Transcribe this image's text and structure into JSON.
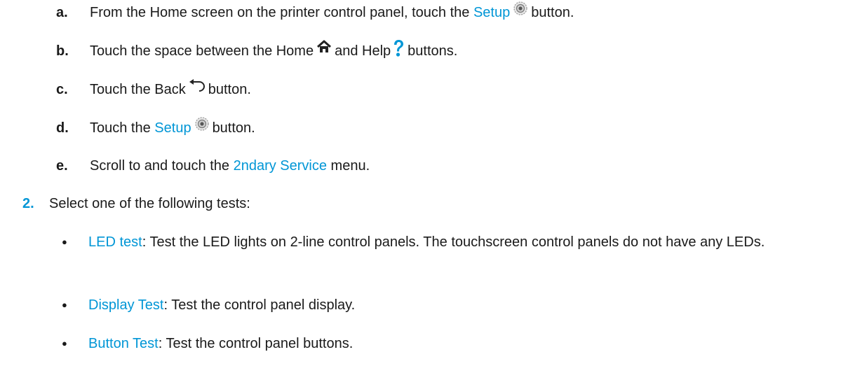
{
  "substeps": [
    {
      "marker": "a.",
      "pre": "From the Home screen on the printer control panel, touch the",
      "link": "Setup",
      "icon": "gear-icon",
      "post": "button."
    },
    {
      "marker": "b.",
      "pre": "Touch the space between the Home",
      "icon1": "home-icon",
      "mid": "and Help",
      "icon2": "help-icon",
      "post": "buttons."
    },
    {
      "marker": "c.",
      "pre": "Touch the Back",
      "icon": "back-arrow-icon",
      "post": "button."
    },
    {
      "marker": "d.",
      "pre": "Touch the",
      "link": "Setup",
      "icon": "gear-icon",
      "post": "button."
    },
    {
      "marker": "e.",
      "pre": "Scroll to and touch the",
      "link": "2ndary Service",
      "post": "menu."
    }
  ],
  "step2": {
    "marker": "2.",
    "text": "Select one of the following tests:"
  },
  "tests": [
    {
      "bullet": "●",
      "link": "LED test",
      "text": ": Test the LED lights on 2-line control panels. The touchscreen control panels do not have any LEDs."
    },
    {
      "bullet": "●",
      "link": "Display Test",
      "text": ": Test the control panel display."
    },
    {
      "bullet": "●",
      "link": "Button Test",
      "text": ": Test the control panel buttons."
    }
  ],
  "colors": {
    "link": "#0096d6",
    "text": "#1a1a1a",
    "help_icon": "#0096d6"
  }
}
